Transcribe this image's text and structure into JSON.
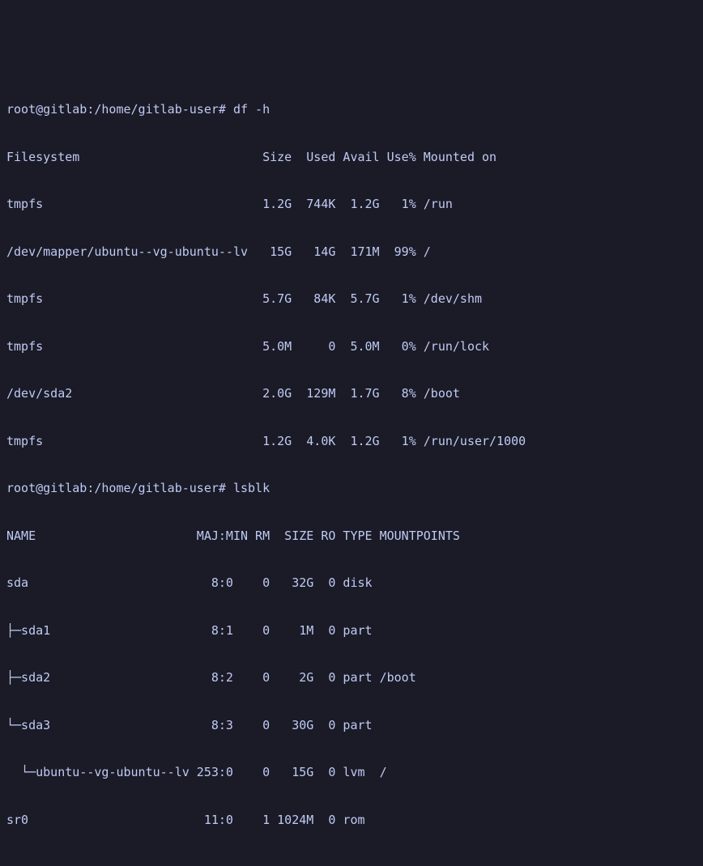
{
  "prompt1": "root@gitlab:/home/gitlab-user# ",
  "cmd1": "df -h",
  "df_header": "Filesystem                         Size  Used Avail Use% Mounted on",
  "df_rows": [
    "tmpfs                              1.2G  744K  1.2G   1% /run",
    "/dev/mapper/ubuntu--vg-ubuntu--lv   15G   14G  171M  99% /",
    "tmpfs                              5.7G   84K  5.7G   1% /dev/shm",
    "tmpfs                              5.0M     0  5.0M   0% /run/lock",
    "/dev/sda2                          2.0G  129M  1.7G   8% /boot",
    "tmpfs                              1.2G  4.0K  1.2G   1% /run/user/1000"
  ],
  "prompt2": "root@gitlab:/home/gitlab-user# ",
  "cmd2": "lsblk",
  "lsblk_header": "NAME                      MAJ:MIN RM  SIZE RO TYPE MOUNTPOINTS",
  "lsblk_rows": [
    "sda                         8:0    0   32G  0 disk ",
    "├─sda1                      8:1    0    1M  0 part ",
    "├─sda2                      8:2    0    2G  0 part /boot",
    "└─sda3                      8:3    0   30G  0 part ",
    "  └─ubuntu--vg-ubuntu--lv 253:0    0   15G  0 lvm  /",
    "sr0                        11:0    1 1024M  0 rom  "
  ],
  "chart_data": {
    "type": "table",
    "tables": [
      {
        "name": "df -h",
        "columns": [
          "Filesystem",
          "Size",
          "Used",
          "Avail",
          "Use%",
          "Mounted on"
        ],
        "rows": [
          [
            "tmpfs",
            "1.2G",
            "744K",
            "1.2G",
            "1%",
            "/run"
          ],
          [
            "/dev/mapper/ubuntu--vg-ubuntu--lv",
            "15G",
            "14G",
            "171M",
            "99%",
            "/"
          ],
          [
            "tmpfs",
            "5.7G",
            "84K",
            "5.7G",
            "1%",
            "/dev/shm"
          ],
          [
            "tmpfs",
            "5.0M",
            "0",
            "5.0M",
            "0%",
            "/run/lock"
          ],
          [
            "/dev/sda2",
            "2.0G",
            "129M",
            "1.7G",
            "8%",
            "/boot"
          ],
          [
            "tmpfs",
            "1.2G",
            "4.0K",
            "1.2G",
            "1%",
            "/run/user/1000"
          ]
        ]
      },
      {
        "name": "lsblk",
        "columns": [
          "NAME",
          "MAJ:MIN",
          "RM",
          "SIZE",
          "RO",
          "TYPE",
          "MOUNTPOINTS"
        ],
        "rows": [
          [
            "sda",
            "8:0",
            "0",
            "32G",
            "0",
            "disk",
            ""
          ],
          [
            "├─sda1",
            "8:1",
            "0",
            "1M",
            "0",
            "part",
            ""
          ],
          [
            "├─sda2",
            "8:2",
            "0",
            "2G",
            "0",
            "part",
            "/boot"
          ],
          [
            "└─sda3",
            "8:3",
            "0",
            "30G",
            "0",
            "part",
            ""
          ],
          [
            "  └─ubuntu--vg-ubuntu--lv",
            "253:0",
            "0",
            "15G",
            "0",
            "lvm",
            "/"
          ],
          [
            "sr0",
            "11:0",
            "1",
            "1024M",
            "0",
            "rom",
            ""
          ]
        ]
      }
    ]
  }
}
